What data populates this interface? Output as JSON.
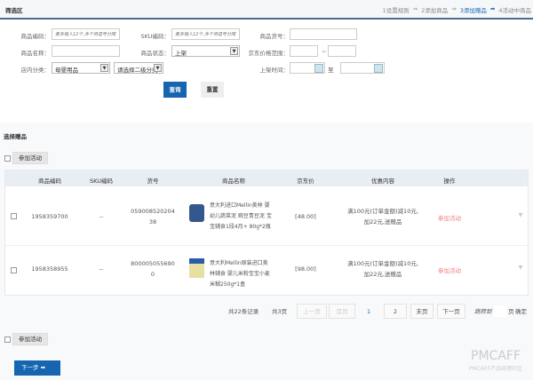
{
  "header": {
    "title": "筛选区",
    "steps": [
      "1设置规则",
      "2添加商品",
      "3添加赠品",
      "4活动中商品"
    ],
    "arrow": "⇒"
  },
  "filter": {
    "code_label": "商品编码：",
    "code_placeholder": "最多输入12个,多个用逗号分隔",
    "sku_label": "SKU编码：",
    "sku_placeholder": "最多输入12个,多个用逗号分隔",
    "item_no_label": "商品货号：",
    "name_label": "商品名称：",
    "status_label": "商品状态：",
    "status_value": "上架",
    "price_label": "京东价格范围：",
    "price_sep": "~",
    "cat_label": "店内分类：",
    "cat1_value": "母婴用品",
    "cat2_value": "请选择二级分类",
    "time_label": "上架时间：",
    "time_sep": "至",
    "query": "查询",
    "reset": "重置"
  },
  "gift": {
    "title": "选择赠品",
    "join": "参加活动",
    "columns": [
      "商品编码",
      "SKU编码",
      "货号",
      "商品名称",
      "京东价",
      "优惠内容",
      "操作"
    ],
    "rows": [
      {
        "code": "1958359700",
        "sku": "--",
        "no": "05900852020438",
        "name": "意大利进口Mellin美林 婴幼儿蔬菜泥 豌豆青豆泥 宝宝辅食1段4月+ 80g*2瓶",
        "price": "[48.00]",
        "promo": "满100元(订单金额)减10元,加22元,送赠品",
        "action": "参加活动"
      },
      {
        "code": "1958358955",
        "sku": "--",
        "no": "8000050556900",
        "name": "意大利Mellin原装进口美林辅食 婴儿米粉宝宝小麦米糊250g*1盒",
        "price": "[98.00]",
        "promo": "满100元(订单金额)减10元,加22元,送赠品",
        "action": "参加活动"
      }
    ]
  },
  "pagination": {
    "total": "共22条记录",
    "pages": "共3页",
    "prev": "上一页",
    "first": "首页",
    "p1": "1",
    "p2": "2",
    "last": "末页",
    "next": "下一页",
    "jump": "跳转到",
    "page_unit": "页",
    "ok": "确定"
  },
  "footer": {
    "join": "参加活动",
    "next": "下一步"
  },
  "watermark": {
    "brand": "PMCAFF",
    "sub": "PMCAFF产品经理社区"
  }
}
